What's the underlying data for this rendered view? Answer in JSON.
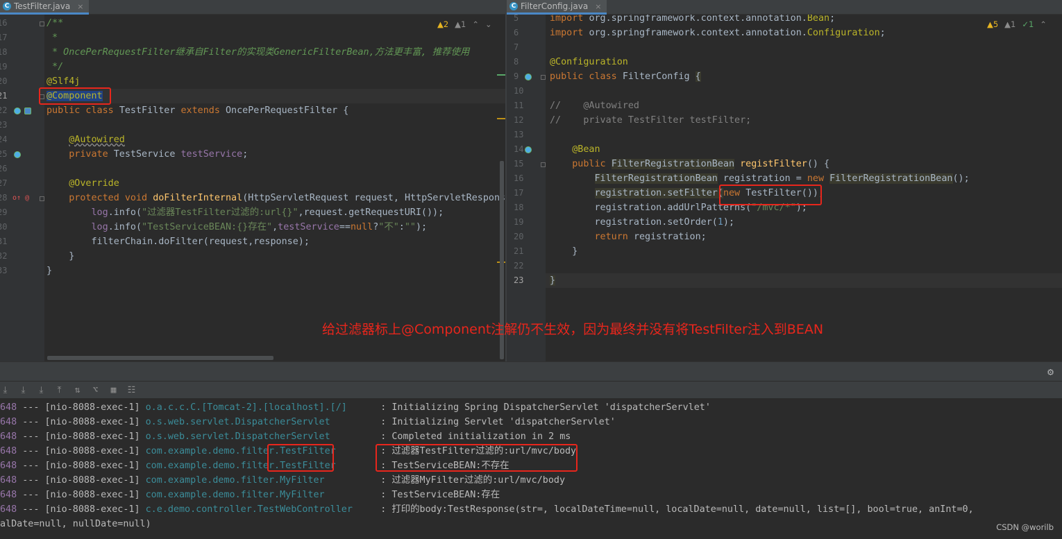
{
  "left_editor": {
    "tab": {
      "icon": "C",
      "label": "TestFilter.java",
      "close": "×"
    },
    "inspections": {
      "warnings": "▲2",
      "weak": "▲1",
      "up": "⌃",
      "down": "⌄"
    },
    "line_numbers": [
      "16",
      "17",
      "18",
      "19",
      "20",
      "21",
      "22",
      "23",
      "24",
      "25",
      "26",
      "27",
      "28",
      "29",
      "30",
      "31",
      "32",
      "33"
    ]
  },
  "right_editor": {
    "tab": {
      "icon": "C",
      "label": "FilterConfig.java",
      "close": "×"
    },
    "inspections": {
      "warnings": "▲5",
      "weak": "▲1",
      "ok": "✓1",
      "up": "⌃"
    },
    "line_numbers": [
      "5",
      "6",
      "7",
      "8",
      "9",
      "10",
      "11",
      "12",
      "13",
      "14",
      "15",
      "16",
      "17",
      "18",
      "19",
      "20",
      "21",
      "22",
      "23"
    ]
  },
  "annotation_note": "给过滤器标上@Component注解仍不生效，因为最终并没有将TestFilter注入到BEAN",
  "toolbar": {
    "icons": [
      "⤓",
      "⤓",
      "⤓",
      "⤒",
      "⇅",
      "⌥",
      "▦",
      "☷"
    ],
    "settings_icon": "⚙"
  },
  "console": {
    "lines": [
      {
        "pid": "648",
        "thread": " --- [nio-8088-exec-1] ",
        "logger": "o.a.c.c.C.[Tomcat-2].[localhost].[/]     ",
        "msg": " : Initializing Spring DispatcherServlet 'dispatcherServlet'"
      },
      {
        "pid": "648",
        "thread": " --- [nio-8088-exec-1] ",
        "logger": "o.s.web.servlet.DispatcherServlet        ",
        "msg": " : Initializing Servlet 'dispatcherServlet'"
      },
      {
        "pid": "648",
        "thread": " --- [nio-8088-exec-1] ",
        "logger": "o.s.web.servlet.DispatcherServlet        ",
        "msg": " : Completed initialization in 2 ms"
      },
      {
        "pid": "648",
        "thread": " --- [nio-8088-exec-1] ",
        "logger": "com.example.demo.filter.TestFilter       ",
        "msg": " : 过滤器TestFilter过滤的:url/mvc/body"
      },
      {
        "pid": "648",
        "thread": " --- [nio-8088-exec-1] ",
        "logger": "com.example.demo.filter.TestFilter       ",
        "msg": " : TestServiceBEAN:不存在"
      },
      {
        "pid": "648",
        "thread": " --- [nio-8088-exec-1] ",
        "logger": "com.example.demo.filter.MyFilter         ",
        "msg": " : 过滤器MyFilter过滤的:url/mvc/body"
      },
      {
        "pid": "648",
        "thread": " --- [nio-8088-exec-1] ",
        "logger": "com.example.demo.filter.MyFilter         ",
        "msg": " : TestServiceBEAN:存在"
      },
      {
        "pid": "648",
        "thread": " --- [nio-8088-exec-1] ",
        "logger": "c.e.demo.controller.TestWebController    ",
        "msg": " : 打印的body:TestResponse(str=, localDateTime=null, localDate=null, date=null, list=[], bool=true, anInt=0,"
      }
    ],
    "wrap_line": "alDate=null, nullDate=null)"
  },
  "watermark": "CSDN @worilb"
}
